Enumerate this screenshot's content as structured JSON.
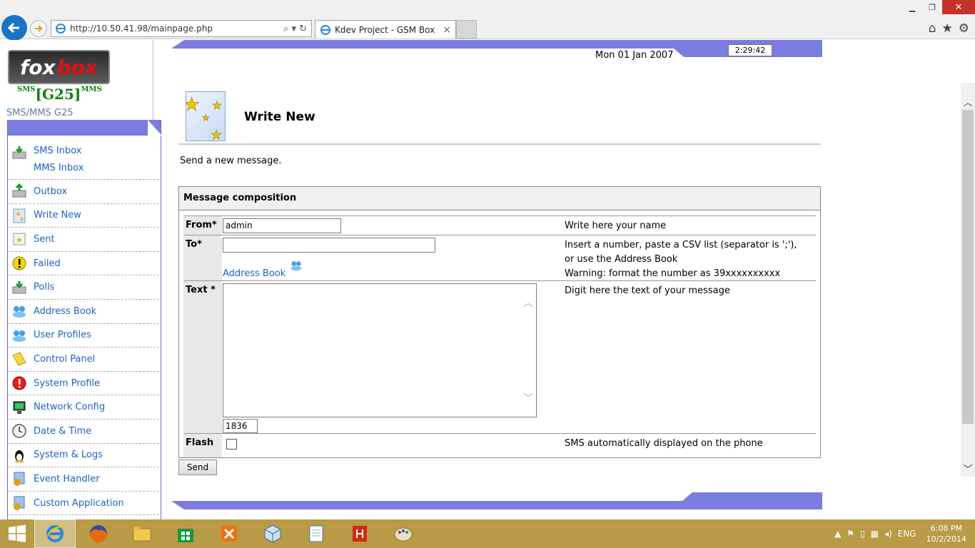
{
  "browser": {
    "url": "http://10.50.41.98/mainpage.php",
    "tab_title": "Kdev Project - GSM Box",
    "tab_close": "×",
    "search_ctl": "⌕ ▾ ↻"
  },
  "sidebar": {
    "logo_fox": "fox",
    "logo_box": "box",
    "brand_sms": "SMS",
    "brand_model": "[G25]",
    "brand_mms": "MMS",
    "subtitle": "SMS/MMS G25",
    "items": [
      {
        "label": "SMS Inbox",
        "label2": "MMS Inbox",
        "icon": "inbox-icon"
      },
      {
        "label": "Outbox",
        "icon": "outbox-icon"
      },
      {
        "label": "Write New",
        "icon": "write-new-icon"
      },
      {
        "label": "Sent",
        "icon": "sent-icon"
      },
      {
        "label": "Failed",
        "icon": "failed-icon"
      },
      {
        "label": "Polls",
        "icon": "polls-icon"
      },
      {
        "label": "Address Book",
        "icon": "address-book-icon"
      },
      {
        "label": "User Profiles",
        "icon": "user-profiles-icon"
      },
      {
        "label": "Control Panel",
        "icon": "control-panel-icon"
      },
      {
        "label": "System Profile",
        "icon": "system-profile-icon"
      },
      {
        "label": "Network Config",
        "icon": "network-config-icon"
      },
      {
        "label": "Date & Time",
        "icon": "clock-icon"
      },
      {
        "label": "System & Logs",
        "icon": "linux-penguin-icon"
      },
      {
        "label": "Event Handler",
        "icon": "event-handler-icon"
      },
      {
        "label": "Custom Application",
        "icon": "custom-app-icon"
      }
    ]
  },
  "header": {
    "date": "Mon 01 Jan 2007",
    "time": "2:29:42"
  },
  "main": {
    "title": "Write New",
    "description": "Send a new message.",
    "form": {
      "heading": "Message composition",
      "from_label": "From*",
      "from_value": "admin",
      "from_help": "Write here your name",
      "to_label": "To*",
      "to_value": "",
      "address_book_link": "Address Book",
      "to_help_1": "Insert a number, paste a CSV list (separator is ';'),",
      "to_help_2": "or use the Address Book",
      "to_help_3": "Warning: format the number as 39xxxxxxxxxx",
      "text_label": "Text *",
      "text_value": "",
      "text_help": "Digit here the text of your message",
      "char_counter": "1836",
      "flash_label": "Flash",
      "flash_checked": false,
      "flash_help": "SMS automatically displayed on the phone",
      "send_label": "Send"
    }
  },
  "taskbar": {
    "language": "ENG",
    "time": "6:08 PM",
    "date": "10/2/2014"
  },
  "colors": {
    "accent_band": "#7b7be0",
    "link": "#1a63c6",
    "taskbar": "#b99a45"
  }
}
